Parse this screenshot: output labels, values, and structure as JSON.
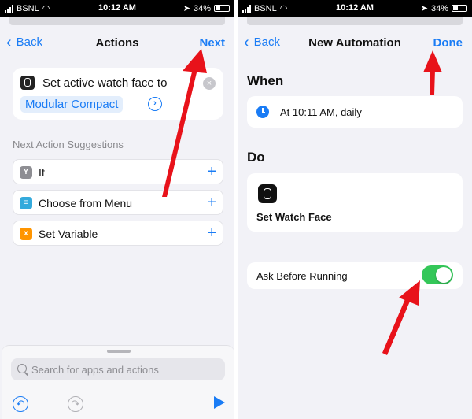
{
  "status_bar": {
    "carrier": "BSNL",
    "time": "10:12 AM",
    "battery": "34%"
  },
  "left": {
    "nav": {
      "back_label": "Back",
      "title": "Actions",
      "action_label": "Next"
    },
    "action_card": {
      "text": "Set active watch face to",
      "param": "Modular Compact"
    },
    "suggestions_title": "Next Action Suggestions",
    "suggestions": [
      {
        "label": "If",
        "icon": "if-icon",
        "icon_color": "#8e8e93"
      },
      {
        "label": "Choose from Menu",
        "icon": "menu-icon",
        "icon_color": "#34aadc"
      },
      {
        "label": "Set Variable",
        "icon": "variable-icon",
        "icon_color": "#ff9500"
      }
    ],
    "search": {
      "placeholder": "Search for apps and actions"
    }
  },
  "right": {
    "nav": {
      "back_label": "Back",
      "title": "New Automation",
      "action_label": "Done"
    },
    "when_heading": "When",
    "trigger": "At 10:11 AM, daily",
    "do_heading": "Do",
    "action_label": "Set Watch Face",
    "ask_label": "Ask Before Running",
    "ask_before_running": true
  },
  "colors": {
    "accent": "#1a7cf5",
    "toggle_on": "#34c759",
    "annotation_arrow": "#e8121a"
  }
}
